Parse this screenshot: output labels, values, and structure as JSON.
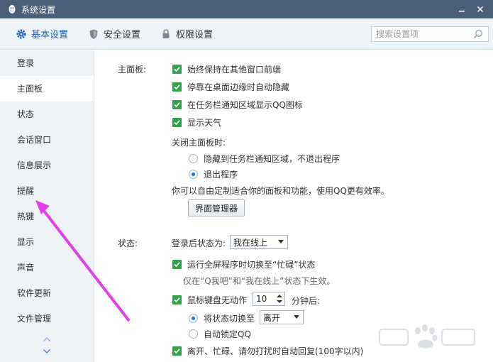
{
  "window": {
    "title": "系统设置"
  },
  "toolbar": {
    "tabs": [
      {
        "label": "基本设置",
        "icon": "gear-icon",
        "active": true
      },
      {
        "label": "安全设置",
        "icon": "shield-icon",
        "active": false
      },
      {
        "label": "权限设置",
        "icon": "lock-icon",
        "active": false
      }
    ],
    "search_placeholder": "搜索设置项"
  },
  "sidebar": {
    "items": [
      {
        "label": "登录"
      },
      {
        "label": "主面板",
        "selected": true
      },
      {
        "label": "状态"
      },
      {
        "label": "会话窗口"
      },
      {
        "label": "信息展示"
      },
      {
        "label": "提醒"
      },
      {
        "label": "热键"
      },
      {
        "label": "显示"
      },
      {
        "label": "声音"
      },
      {
        "label": "软件更新"
      },
      {
        "label": "文件管理"
      }
    ]
  },
  "main_panel": {
    "section_label": "主面板:",
    "options": [
      {
        "label": "始终保持在其他窗口前端",
        "checked": true
      },
      {
        "label": "停靠在桌面边缘时自动隐藏",
        "checked": true
      },
      {
        "label": "在任务栏通知区域显示QQ图标",
        "checked": true
      },
      {
        "label": "显示天气",
        "checked": true
      }
    ],
    "close_label": "关闭主面板时:",
    "close_options": [
      {
        "label": "隐藏到任务栏通知区域，不退出程序",
        "selected": false
      },
      {
        "label": "退出程序",
        "selected": true
      }
    ],
    "customize_text": "你可以自由定制适合你的面板和功能，使用QQ更有效率。",
    "ui_manager_button": "界面管理器"
  },
  "status": {
    "section_label": "状态:",
    "login_status_label": "登录后状态为:",
    "login_status_value": "我在线上",
    "fullscreen_option": {
      "label": "运行全屏程序时切换至“忙碌”状态",
      "checked": true
    },
    "fullscreen_note": "仅在“Q我吧”和“我在线上”状态下生效。",
    "idle_option": {
      "label": "鼠标键盘无动作",
      "checked": true
    },
    "idle_minutes": "10",
    "idle_minutes_suffix": "分钟后:",
    "idle_actions": [
      {
        "label": "将状态切换至",
        "selected": true
      },
      {
        "label": "自动锁定QQ",
        "selected": false
      }
    ],
    "switch_to_value": "离开",
    "auto_reply_option": {
      "label": "离开、忙碌、请勿打扰时自动回复(100字以内)",
      "checked": true
    }
  },
  "colors": {
    "titlebar": "#4a5f7a",
    "accent": "#1a5fb4",
    "checkbox": "#2fa34a",
    "annotation_arrow": "#e040e8"
  }
}
